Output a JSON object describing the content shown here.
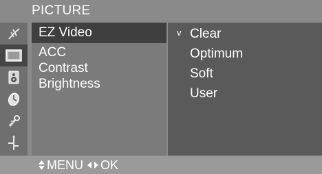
{
  "title": "PICTURE",
  "sidebar_icons": [
    {
      "name": "antenna-icon"
    },
    {
      "name": "picture-icon",
      "selected": true
    },
    {
      "name": "speaker-icon"
    },
    {
      "name": "clock-icon"
    },
    {
      "name": "wrench-icon"
    },
    {
      "name": "signal-input-icon"
    }
  ],
  "menu_items": [
    "EZ Video",
    "ACC",
    "Contrast",
    "Brightness"
  ],
  "selected_menu_item": "EZ Video",
  "submenu": {
    "check_mark": "v",
    "items": [
      "Clear",
      "Optimum",
      "Soft",
      "User"
    ],
    "checked_item": "Clear"
  },
  "footer": {
    "menu_label": "MENU",
    "ok_label": "OK"
  },
  "colors": {
    "panel": "#8a8a8a",
    "icon_column": "#6f6f6f",
    "menu_column": "#7b7b7b",
    "submenu_column": "#5a5a5a",
    "selection": "#3f3f3f",
    "text": "#ffffff"
  }
}
